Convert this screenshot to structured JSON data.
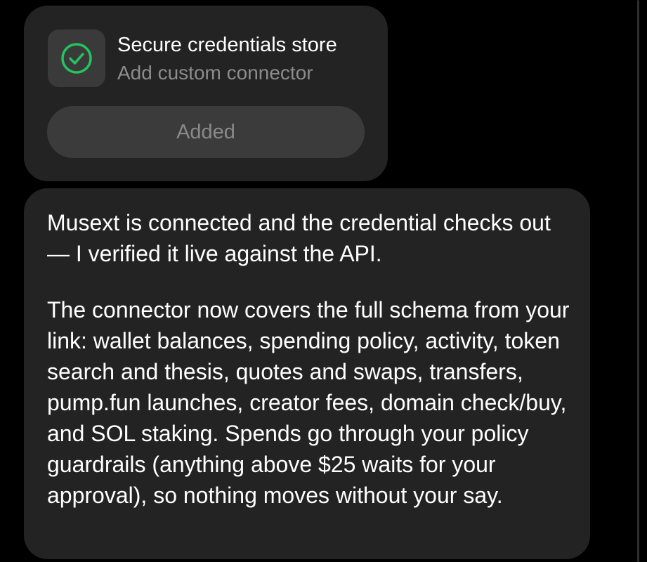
{
  "connector_card": {
    "icon": "check-circle-icon",
    "accent_color": "#22c55e",
    "title": "Secure credentials store",
    "subtitle": "Add custom connector",
    "button_label": "Added"
  },
  "message": {
    "paragraphs": [
      "Musext is connected and the credential checks out — I verified it live against the API.",
      "The connector now covers the full schema from your link: wallet balances, spending policy, activity, token search and thesis, quotes and swaps, transfers, pump.fun launches, creator fees, domain check/buy, and SOL staking. Spends go through your policy guardrails (anything above $25 waits for your approval), so nothing moves without your say."
    ]
  }
}
